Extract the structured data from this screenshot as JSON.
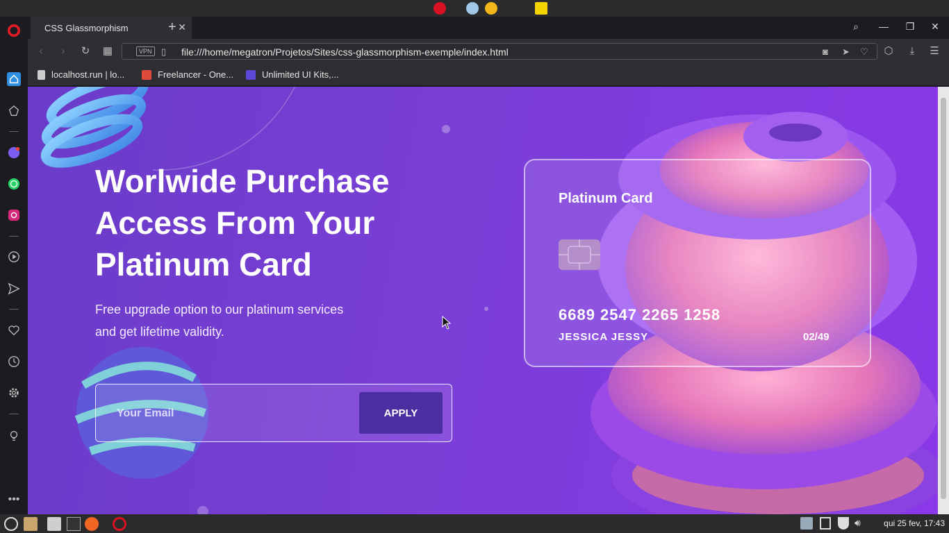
{
  "browser": {
    "tab_title": "CSS Glassmorphism",
    "url": "file:///home/megatron/Projetos/Sites/css-glassmorphism-exemple/index.html",
    "vpn_label": "VPN"
  },
  "bookmarks": [
    {
      "label": "localhost.run | lo...",
      "icon": "page-icon"
    },
    {
      "label": "Freelancer - One...",
      "icon": "s-logo-icon",
      "color": "#e04a3a"
    },
    {
      "label": "Unlimited UI Kits,...",
      "icon": "up-logo-icon",
      "color": "#5b48d6"
    }
  ],
  "page": {
    "hero_title": "Worlwide Purchase Access From Your Platinum Card",
    "hero_subtitle": "Free upgrade option to our platinum services and get lifetime validity.",
    "email_placeholder": "Your Email",
    "apply_label": "APPLY"
  },
  "card": {
    "title": "Platinum Card",
    "number": "6689 2547 2265 1258",
    "holder": "JESSICA JESSY",
    "expiry": "02/49"
  },
  "system": {
    "clock": "qui 25 fev, 17:43"
  }
}
